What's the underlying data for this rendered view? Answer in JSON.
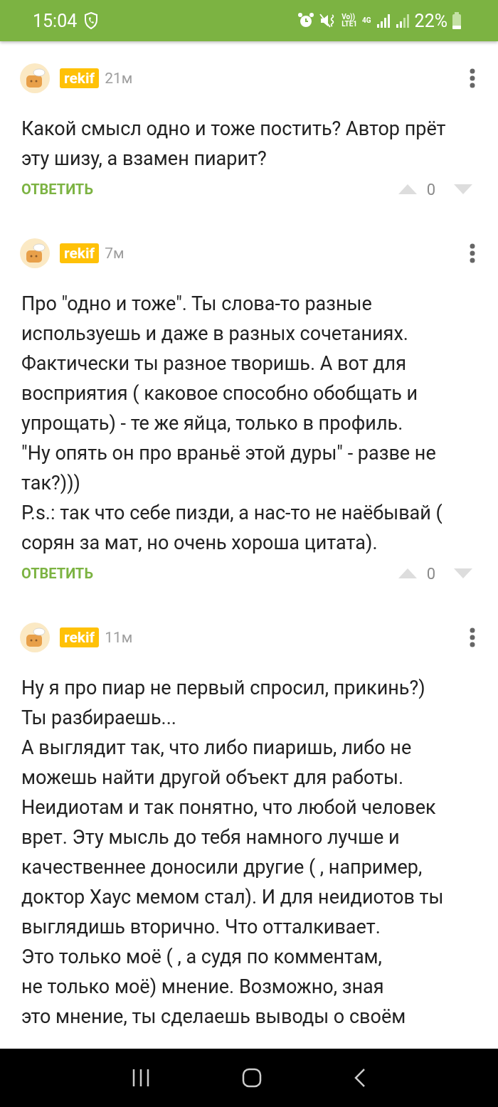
{
  "status_bar": {
    "time": "15:04",
    "network_top": "Vo))",
    "network_bottom": "LTE1",
    "data_type": "4G",
    "battery": "22%"
  },
  "comments": [
    {
      "author": "rekif",
      "time": "21м",
      "text": "Какой смысл одно и тоже постить? Автор прёт эту шизу, а взамен пиарит?",
      "reply": "ОТВЕТИТЬ",
      "score": "0"
    },
    {
      "author": "rekif",
      "time": "7м",
      "text": "Про \"одно и тоже\". Ты слова-то разные используешь и даже в разных сочетаниях. Фактически ты разное творишь. А вот для восприятия ( каковое способно обобщать и упрощать) - те же яйца, только в профиль.\n\"Ну опять он про враньё этой дуры\" - разве не так?)))\nP.s.: так что себе пизди, а нас-то не наёбывай ( сорян за мат, но очень хороша цитата).",
      "reply": "ОТВЕТИТЬ",
      "score": "0"
    },
    {
      "author": "rekif",
      "time": "11м",
      "text": "Ну я про пиар не первый спросил, прикинь?)\nТы разбираешь...\nА выглядит так, что либо пиаришь, либо не можешь найти другой объект для работы. Неидиотам и так понятно, что любой человек врет. Эту мысль до тебя намного лучше и качественнее доносили другие ( , например, доктор Хаус мемом стал). И для неидиотов ты выглядишь вторично. Что отталкивает.\nЭто только моё ( , а судя по комментам,\nне только моё) мнение. Возможно, зная\nэто мнение, ты сделаешь выводы о своём"
    }
  ]
}
